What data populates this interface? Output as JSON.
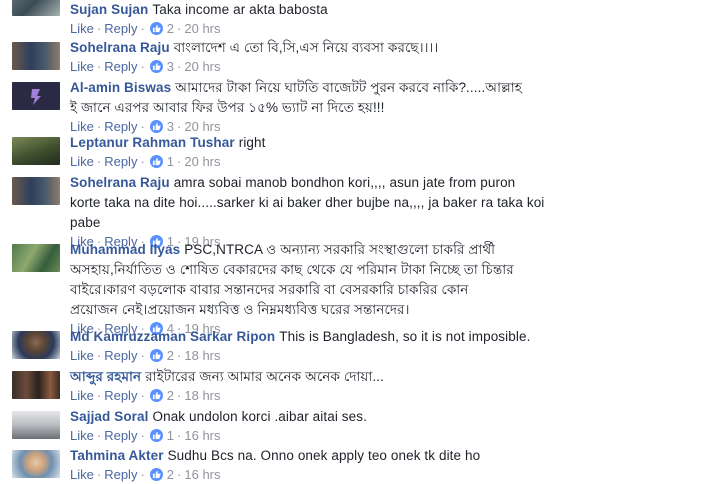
{
  "labels": {
    "like": "Like",
    "reply": "Reply",
    "sep": "·"
  },
  "comments": [
    {
      "name": "Sujan Sujan",
      "lines": [
        "Taka income ar akta babosta"
      ],
      "likes": "2",
      "time": "20 hrs"
    },
    {
      "name": "Sohelrana Raju",
      "lines": [
        "বাংলাদেশ এ তো বি,সি,এস নিয়ে ব্যবসা করছে।।।।"
      ],
      "likes": "3",
      "time": "20 hrs"
    },
    {
      "name": "Al-amin Biswas",
      "lines": [
        "আমাদের টাকা নিয়ে ঘাটতি বাজেটট পুরন করবে নাকি?.....আল্লাহ",
        "ই জানে এরপর আবার ফির উপর ১৫% ভ্যাট না দিতে হয়!!!"
      ],
      "likes": "3",
      "time": "20 hrs"
    },
    {
      "name": "Leptanur Rahman Tushar",
      "lines": [
        "right"
      ],
      "likes": "1",
      "time": "20 hrs"
    },
    {
      "name": "Sohelrana Raju",
      "lines": [
        "amra sobai manob bondhon kori,,,, asun jate from puron",
        "korte taka na dite hoi.....sarker ki ai baker dher bujbe na,,,, ja baker ra taka koi",
        "pabe"
      ],
      "likes": "1",
      "time": "19 hrs"
    },
    {
      "name": "Muhammad Ilyas",
      "lines": [
        "PSC,NTRCA ও অন্যান্য সরকারি সংস্থাগুলো চাকরি প্রার্থী",
        "অসহায়,নির্যাতিত ও শোষিত বেকারদের কাছ থেকে যে পরিমান টাকা নিচ্ছে তা চিন্তার",
        "বাইরে।কারণ বড়লোক বাবার সন্তানদের সরকারি বা বেসরকারি চাকরির কোন",
        "প্রয়োজন নেই।প্রয়োজন মধ্যবিত্ত ও নিম্নমধ্যবিত্ত ঘরের সন্তানদের।"
      ],
      "likes": "4",
      "time": "19 hrs"
    },
    {
      "name": "Md Kamruzzaman Sarkar Ripon",
      "lines": [
        "This is Bangladesh, so it is not imposible."
      ],
      "likes": "2",
      "time": "18 hrs"
    },
    {
      "name": "আব্দুর রহমান",
      "lines": [
        "রাইটারের জন্য আমার অনেক অনেক দোয়া..."
      ],
      "likes": "2",
      "time": "18 hrs"
    },
    {
      "name": "Sajjad Soral",
      "lines": [
        "Onak undolon korci .aibar aitai ses."
      ],
      "likes": "1",
      "time": "16 hrs"
    },
    {
      "name": "Tahmina Akter",
      "lines": [
        "Sudhu Bcs na. Onno onek apply teo onek tk dite ho"
      ],
      "likes": "2",
      "time": "16 hrs"
    }
  ]
}
